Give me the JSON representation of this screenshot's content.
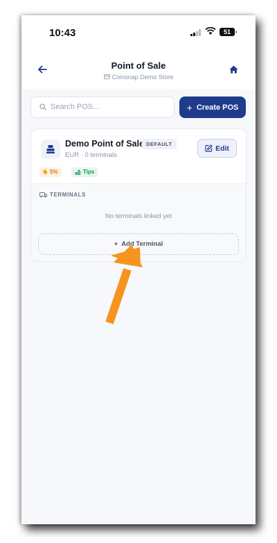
{
  "status_bar": {
    "time": "10:43",
    "battery": "51"
  },
  "header": {
    "title": "Point of Sale",
    "subtitle": "Coinsnap Demo Store"
  },
  "search": {
    "placeholder": "Search POS..."
  },
  "create_button": {
    "label": "Create POS"
  },
  "pos_card": {
    "name": "Demo Point of Sale",
    "badge": "DEFAULT",
    "meta": "EUR · 0 terminals",
    "edit_label": "Edit",
    "fee_tag": "5%",
    "tips_tag": "Tips",
    "terminals_heading": "TERMINALS",
    "empty_text": "No terminals linked yet",
    "add_terminal_label": "Add Terminal"
  },
  "colors": {
    "primary": "#1f3b8c",
    "arrow": "#f7941d",
    "fee": "#d97706",
    "tips": "#15925a"
  },
  "icons": [
    "back-arrow-icon",
    "store-icon",
    "home-icon",
    "search-icon",
    "plus-icon",
    "pos-register-icon",
    "edit-icon",
    "tag-icon",
    "tips-icon",
    "terminal-icon",
    "arrow-pointer"
  ]
}
